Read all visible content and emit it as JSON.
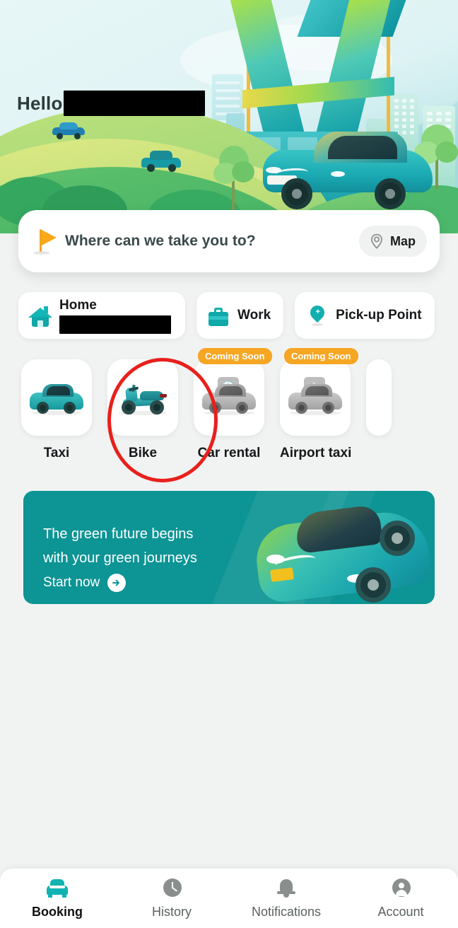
{
  "hero": {
    "greeting_prefix": "Hello",
    "user_name_redacted": true
  },
  "search": {
    "placeholder_text": "Where can we take you to?",
    "flag_icon": "flag-icon",
    "map_button": {
      "label": "Map",
      "icon": "location-pin-icon"
    }
  },
  "quick_places": [
    {
      "label": "Home",
      "icon": "house-icon",
      "has_redacted_address": true
    },
    {
      "label": "Work",
      "icon": "briefcase-icon",
      "has_redacted_address": false
    },
    {
      "label": "Pick-up Point",
      "icon": "map-pin-plus-icon",
      "has_redacted_address": false
    }
  ],
  "services": [
    {
      "label": "Taxi",
      "icon": "car-icon",
      "badge": null,
      "disabled": false
    },
    {
      "label": "Bike",
      "icon": "scooter-icon",
      "badge": null,
      "disabled": false,
      "highlighted": true
    },
    {
      "label": "Car rental",
      "icon": "car-clock-icon",
      "badge": "Coming Soon",
      "disabled": true
    },
    {
      "label": "Airport taxi",
      "icon": "car-plane-icon",
      "badge": "Coming Soon",
      "disabled": true
    }
  ],
  "banner": {
    "title_line1": "The green future begins",
    "title_line2": "with your green journeys",
    "cta_label": "Start now",
    "cta_icon": "arrow-right-icon",
    "background_color": "#0D9494"
  },
  "bottom_nav": [
    {
      "label": "Booking",
      "icon": "car-icon",
      "active": true
    },
    {
      "label": "History",
      "icon": "clock-icon",
      "active": false
    },
    {
      "label": "Notifications",
      "icon": "bell-icon",
      "active": false
    },
    {
      "label": "Account",
      "icon": "user-icon",
      "active": false
    }
  ],
  "colors": {
    "accent_teal": "#12B2B2",
    "banner_teal": "#0D9494",
    "badge_orange": "#F5A623",
    "annotation_red": "#E8201C",
    "page_background": "#F1F3F2"
  }
}
